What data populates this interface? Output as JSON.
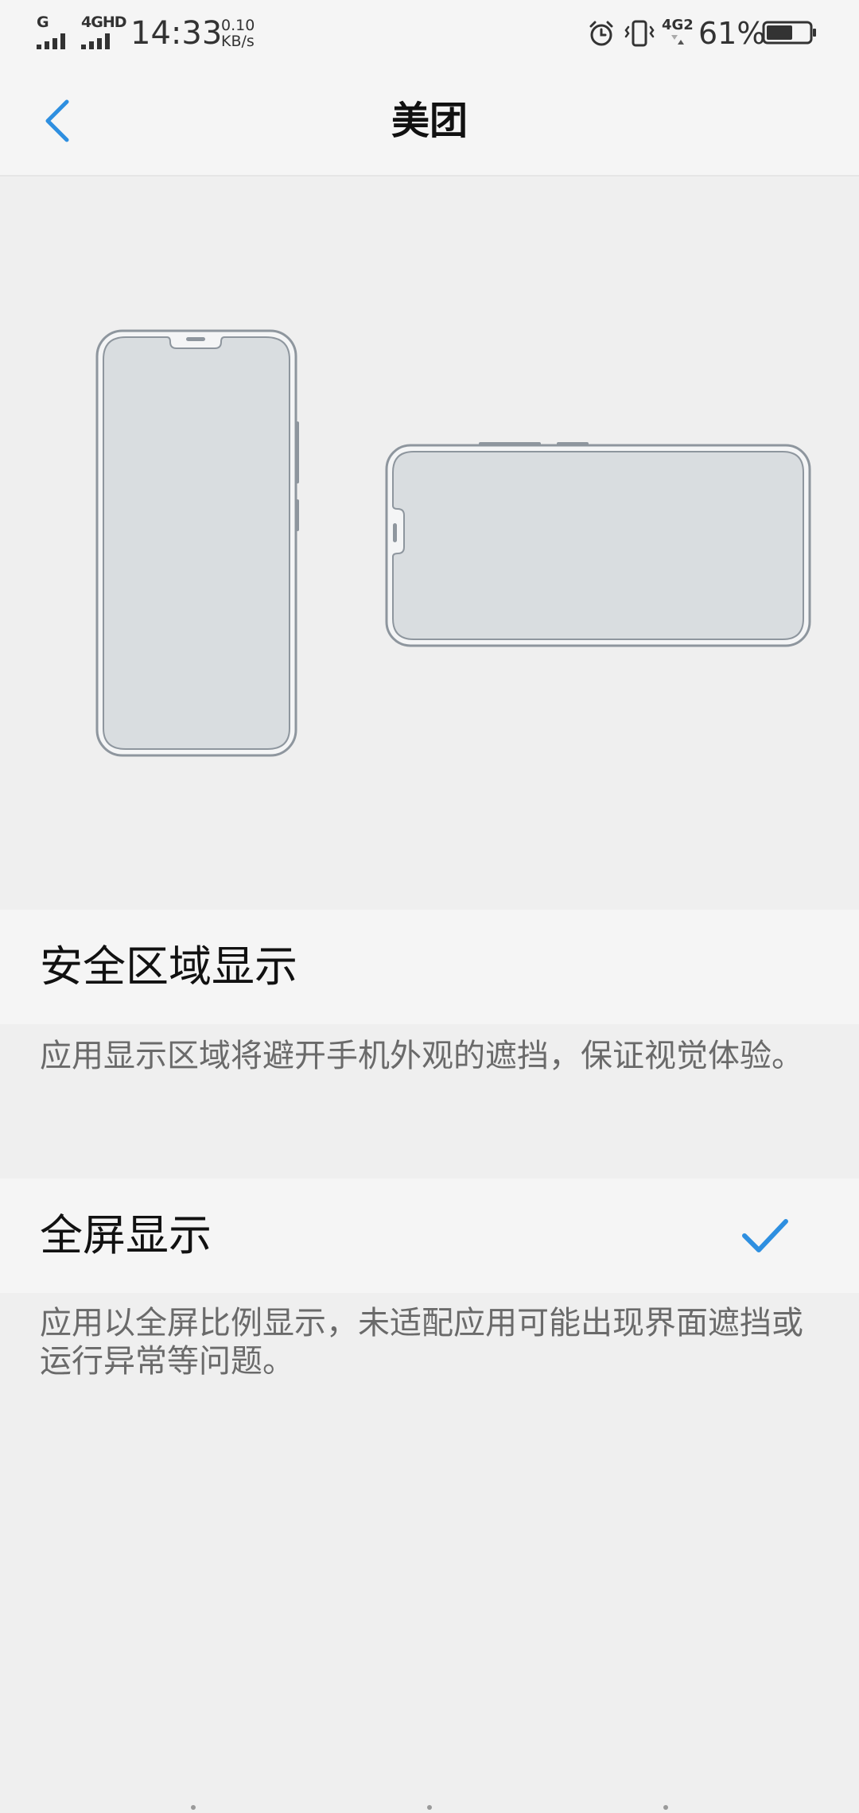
{
  "status_bar": {
    "sim1_network": "G",
    "sim2_network": "4GHD",
    "time": "14:33",
    "speed_value": "0.10",
    "speed_unit": "KB/s",
    "icons": [
      "alarm-icon",
      "vibrate-icon"
    ],
    "sim2_data": "4G2",
    "battery_percent": "61%",
    "battery_level": 0.61
  },
  "nav": {
    "title": "美团"
  },
  "options": [
    {
      "label": "安全区域显示",
      "description": "应用显示区域将避开手机外观的遮挡，保证视觉体验。",
      "selected": false
    },
    {
      "label": "全屏显示",
      "description": "应用以全屏比例显示，未适配应用可能出现界面遮挡或运行异常等问题。",
      "selected": true
    }
  ],
  "colors": {
    "accent": "#2e8fe0",
    "background": "#efefef",
    "row_background": "#f5f5f5",
    "device_outline": "#8e969e",
    "device_screen": "#d9dde0",
    "secondary_text": "#6a6a6a"
  }
}
